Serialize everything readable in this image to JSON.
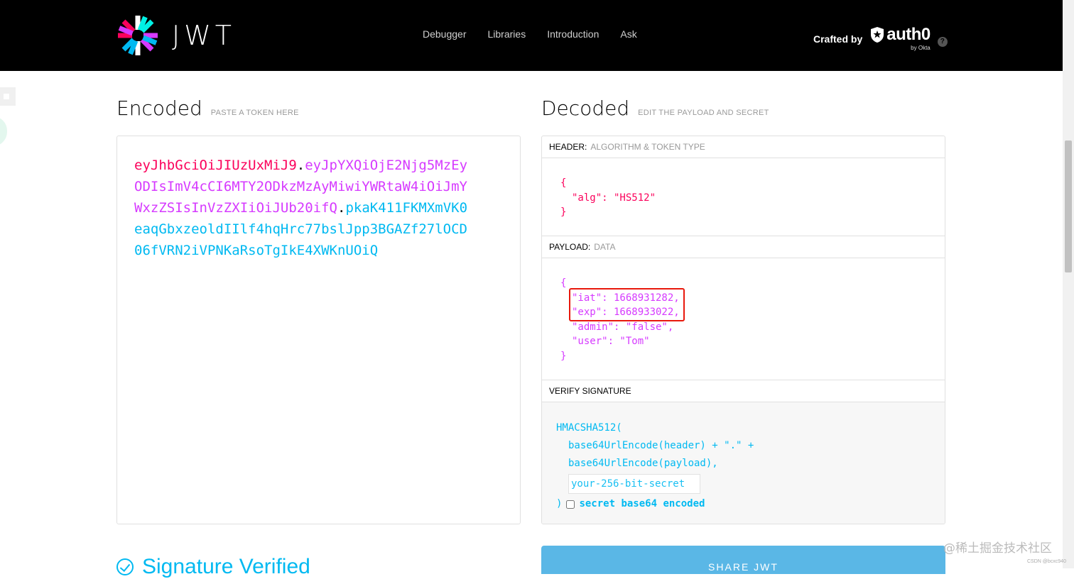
{
  "header": {
    "logo_text": "JWT",
    "nav": [
      "Debugger",
      "Libraries",
      "Introduction",
      "Ask"
    ],
    "crafted_by": "Crafted by",
    "brand": "auth0",
    "brand_sub": "by Okta",
    "help": "?"
  },
  "encoded": {
    "title": "Encoded",
    "subtitle": "PASTE A TOKEN HERE",
    "token_header": "eyJhbGciOiJIUzUxMiJ9",
    "token_payload": "eyJpYXQiOjE2Njg5MzEyODIsImV4cCI6MTY2ODkzMzAyMiwiYWRtaW4iOiJmYWxzZSIsInVzZXIiOiJUb20ifQ",
    "token_signature": "pkaK411FKMXmVK0eaqGbxzeoldIIlf4hqHrc77bslJpp3BGAZf27lOCD06fVRN2iVPNKaRsoTgIkE4XWKnUOiQ",
    "dot": "."
  },
  "decoded": {
    "title": "Decoded",
    "subtitle": "EDIT THE PAYLOAD AND SECRET",
    "header_pane": {
      "label": "HEADER:",
      "sub": "ALGORITHM & TOKEN TYPE",
      "open": "{",
      "line1": "\"alg\": \"HS512\"",
      "close": "}"
    },
    "payload_pane": {
      "label": "PAYLOAD:",
      "sub": "DATA",
      "open": "{",
      "lines": [
        "\"iat\": 1668931282,",
        "\"exp\": 1668933022,",
        "\"admin\": \"false\",",
        "\"user\": \"Tom\""
      ],
      "close": "}"
    },
    "verify_pane": {
      "label": "VERIFY SIGNATURE",
      "fn": "HMACSHA512(",
      "arg1": "base64UrlEncode(header) + \".\" +",
      "arg2": "base64UrlEncode(payload),",
      "secret_placeholder": "your-256-bit-secret",
      "close": ")",
      "b64_label": "secret base64 encoded"
    }
  },
  "footer": {
    "verified": "Signature Verified",
    "share": "SHARE JWT"
  },
  "watermark": "@稀土掘金技术社区",
  "watermark_small": "CSDN @bcxc940",
  "colors": {
    "header_part": "#fb015b",
    "payload_part": "#d63aff",
    "signature_part": "#00b9f1",
    "highlight_box": "#e8180c",
    "share_button": "#5ab7e6"
  }
}
